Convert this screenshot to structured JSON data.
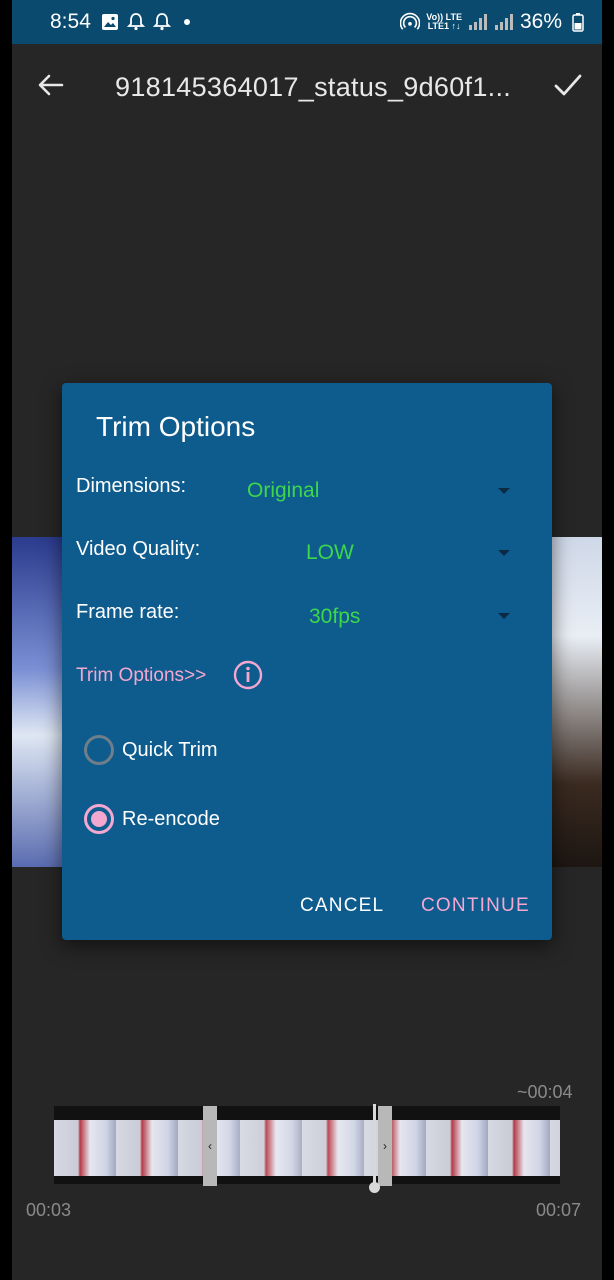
{
  "status_bar": {
    "time": "8:54",
    "network_top": "Vo)) LTE",
    "network_bottom": "LTE1 ↑↓",
    "battery": "36%"
  },
  "app_bar": {
    "title": "918145364017_status_9d60f1..."
  },
  "dialog": {
    "title": "Trim Options",
    "rows": [
      {
        "label": "Dimensions:",
        "value": "Original"
      },
      {
        "label": "Video Quality:",
        "value": "LOW"
      },
      {
        "label": "Frame rate:",
        "value": "30fps"
      }
    ],
    "trim_link": "Trim Options>>",
    "options": [
      {
        "label": "Quick Trim",
        "selected": false
      },
      {
        "label": "Re-encode",
        "selected": true
      }
    ],
    "cancel_label": "CANCEL",
    "continue_label": "CONTINUE",
    "value_color": "#3ed64a",
    "accent_color": "#f4a7cf"
  },
  "timeline": {
    "duration": "~00:04",
    "start_time": "00:03",
    "end_time": "00:07"
  }
}
